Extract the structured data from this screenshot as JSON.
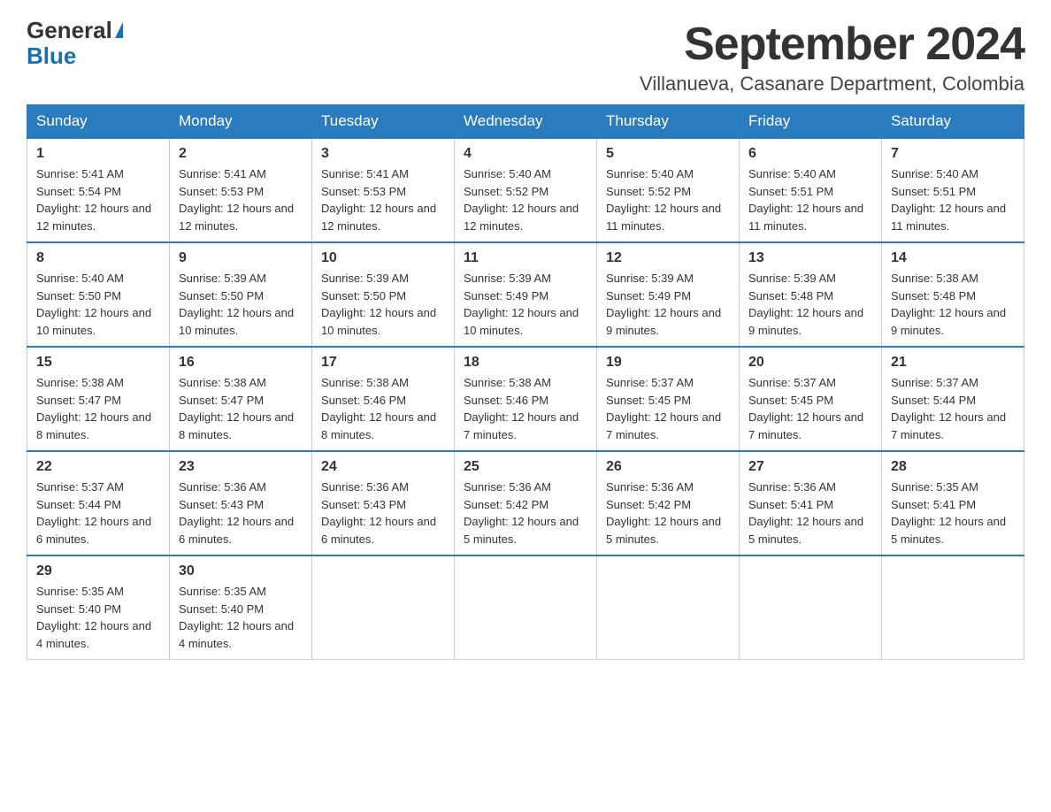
{
  "logo": {
    "line1": "General",
    "line2": "Blue"
  },
  "title": {
    "month_year": "September 2024",
    "location": "Villanueva, Casanare Department, Colombia"
  },
  "headers": [
    "Sunday",
    "Monday",
    "Tuesday",
    "Wednesday",
    "Thursday",
    "Friday",
    "Saturday"
  ],
  "weeks": [
    [
      {
        "day": "1",
        "sunrise": "Sunrise: 5:41 AM",
        "sunset": "Sunset: 5:54 PM",
        "daylight": "Daylight: 12 hours and 12 minutes."
      },
      {
        "day": "2",
        "sunrise": "Sunrise: 5:41 AM",
        "sunset": "Sunset: 5:53 PM",
        "daylight": "Daylight: 12 hours and 12 minutes."
      },
      {
        "day": "3",
        "sunrise": "Sunrise: 5:41 AM",
        "sunset": "Sunset: 5:53 PM",
        "daylight": "Daylight: 12 hours and 12 minutes."
      },
      {
        "day": "4",
        "sunrise": "Sunrise: 5:40 AM",
        "sunset": "Sunset: 5:52 PM",
        "daylight": "Daylight: 12 hours and 12 minutes."
      },
      {
        "day": "5",
        "sunrise": "Sunrise: 5:40 AM",
        "sunset": "Sunset: 5:52 PM",
        "daylight": "Daylight: 12 hours and 11 minutes."
      },
      {
        "day": "6",
        "sunrise": "Sunrise: 5:40 AM",
        "sunset": "Sunset: 5:51 PM",
        "daylight": "Daylight: 12 hours and 11 minutes."
      },
      {
        "day": "7",
        "sunrise": "Sunrise: 5:40 AM",
        "sunset": "Sunset: 5:51 PM",
        "daylight": "Daylight: 12 hours and 11 minutes."
      }
    ],
    [
      {
        "day": "8",
        "sunrise": "Sunrise: 5:40 AM",
        "sunset": "Sunset: 5:50 PM",
        "daylight": "Daylight: 12 hours and 10 minutes."
      },
      {
        "day": "9",
        "sunrise": "Sunrise: 5:39 AM",
        "sunset": "Sunset: 5:50 PM",
        "daylight": "Daylight: 12 hours and 10 minutes."
      },
      {
        "day": "10",
        "sunrise": "Sunrise: 5:39 AM",
        "sunset": "Sunset: 5:50 PM",
        "daylight": "Daylight: 12 hours and 10 minutes."
      },
      {
        "day": "11",
        "sunrise": "Sunrise: 5:39 AM",
        "sunset": "Sunset: 5:49 PM",
        "daylight": "Daylight: 12 hours and 10 minutes."
      },
      {
        "day": "12",
        "sunrise": "Sunrise: 5:39 AM",
        "sunset": "Sunset: 5:49 PM",
        "daylight": "Daylight: 12 hours and 9 minutes."
      },
      {
        "day": "13",
        "sunrise": "Sunrise: 5:39 AM",
        "sunset": "Sunset: 5:48 PM",
        "daylight": "Daylight: 12 hours and 9 minutes."
      },
      {
        "day": "14",
        "sunrise": "Sunrise: 5:38 AM",
        "sunset": "Sunset: 5:48 PM",
        "daylight": "Daylight: 12 hours and 9 minutes."
      }
    ],
    [
      {
        "day": "15",
        "sunrise": "Sunrise: 5:38 AM",
        "sunset": "Sunset: 5:47 PM",
        "daylight": "Daylight: 12 hours and 8 minutes."
      },
      {
        "day": "16",
        "sunrise": "Sunrise: 5:38 AM",
        "sunset": "Sunset: 5:47 PM",
        "daylight": "Daylight: 12 hours and 8 minutes."
      },
      {
        "day": "17",
        "sunrise": "Sunrise: 5:38 AM",
        "sunset": "Sunset: 5:46 PM",
        "daylight": "Daylight: 12 hours and 8 minutes."
      },
      {
        "day": "18",
        "sunrise": "Sunrise: 5:38 AM",
        "sunset": "Sunset: 5:46 PM",
        "daylight": "Daylight: 12 hours and 7 minutes."
      },
      {
        "day": "19",
        "sunrise": "Sunrise: 5:37 AM",
        "sunset": "Sunset: 5:45 PM",
        "daylight": "Daylight: 12 hours and 7 minutes."
      },
      {
        "day": "20",
        "sunrise": "Sunrise: 5:37 AM",
        "sunset": "Sunset: 5:45 PM",
        "daylight": "Daylight: 12 hours and 7 minutes."
      },
      {
        "day": "21",
        "sunrise": "Sunrise: 5:37 AM",
        "sunset": "Sunset: 5:44 PM",
        "daylight": "Daylight: 12 hours and 7 minutes."
      }
    ],
    [
      {
        "day": "22",
        "sunrise": "Sunrise: 5:37 AM",
        "sunset": "Sunset: 5:44 PM",
        "daylight": "Daylight: 12 hours and 6 minutes."
      },
      {
        "day": "23",
        "sunrise": "Sunrise: 5:36 AM",
        "sunset": "Sunset: 5:43 PM",
        "daylight": "Daylight: 12 hours and 6 minutes."
      },
      {
        "day": "24",
        "sunrise": "Sunrise: 5:36 AM",
        "sunset": "Sunset: 5:43 PM",
        "daylight": "Daylight: 12 hours and 6 minutes."
      },
      {
        "day": "25",
        "sunrise": "Sunrise: 5:36 AM",
        "sunset": "Sunset: 5:42 PM",
        "daylight": "Daylight: 12 hours and 5 minutes."
      },
      {
        "day": "26",
        "sunrise": "Sunrise: 5:36 AM",
        "sunset": "Sunset: 5:42 PM",
        "daylight": "Daylight: 12 hours and 5 minutes."
      },
      {
        "day": "27",
        "sunrise": "Sunrise: 5:36 AM",
        "sunset": "Sunset: 5:41 PM",
        "daylight": "Daylight: 12 hours and 5 minutes."
      },
      {
        "day": "28",
        "sunrise": "Sunrise: 5:35 AM",
        "sunset": "Sunset: 5:41 PM",
        "daylight": "Daylight: 12 hours and 5 minutes."
      }
    ],
    [
      {
        "day": "29",
        "sunrise": "Sunrise: 5:35 AM",
        "sunset": "Sunset: 5:40 PM",
        "daylight": "Daylight: 12 hours and 4 minutes."
      },
      {
        "day": "30",
        "sunrise": "Sunrise: 5:35 AM",
        "sunset": "Sunset: 5:40 PM",
        "daylight": "Daylight: 12 hours and 4 minutes."
      },
      null,
      null,
      null,
      null,
      null
    ]
  ]
}
